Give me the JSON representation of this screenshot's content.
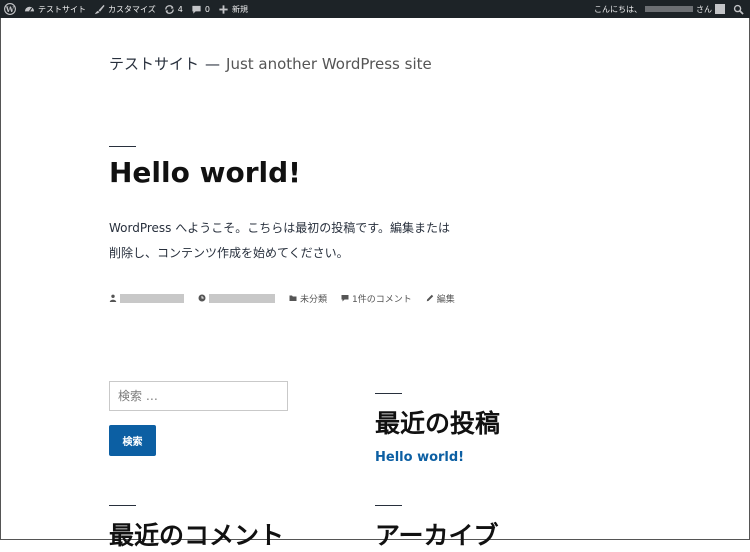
{
  "adminbar": {
    "site_name": "テストサイト",
    "customize": "カスタマイズ",
    "updates_count": "4",
    "comments_count": "0",
    "new_label": "新規",
    "greeting": "こんにちは、",
    "san": "さん"
  },
  "site": {
    "title": "テストサイト",
    "separator": "—",
    "description": "Just another WordPress site"
  },
  "post": {
    "title": "Hello world!",
    "body_line1": "WordPress へようこそ。こちらは最初の投稿です。編集または",
    "body_line2": "削除し、コンテンツ作成を始めてください。",
    "category": "未分類",
    "comments": "1件のコメント",
    "edit": "編集"
  },
  "widgets": {
    "search_placeholder": "検索 …",
    "search_button": "検索",
    "recent_posts_title": "最近の投稿",
    "recent_post_link": "Hello world!",
    "recent_comments_title": "最近のコメント",
    "archives_title": "アーカイブ"
  },
  "colors": {
    "adminbar_bg": "#1d2327",
    "link": "#0c5fa3",
    "button": "#0c5fa3"
  }
}
